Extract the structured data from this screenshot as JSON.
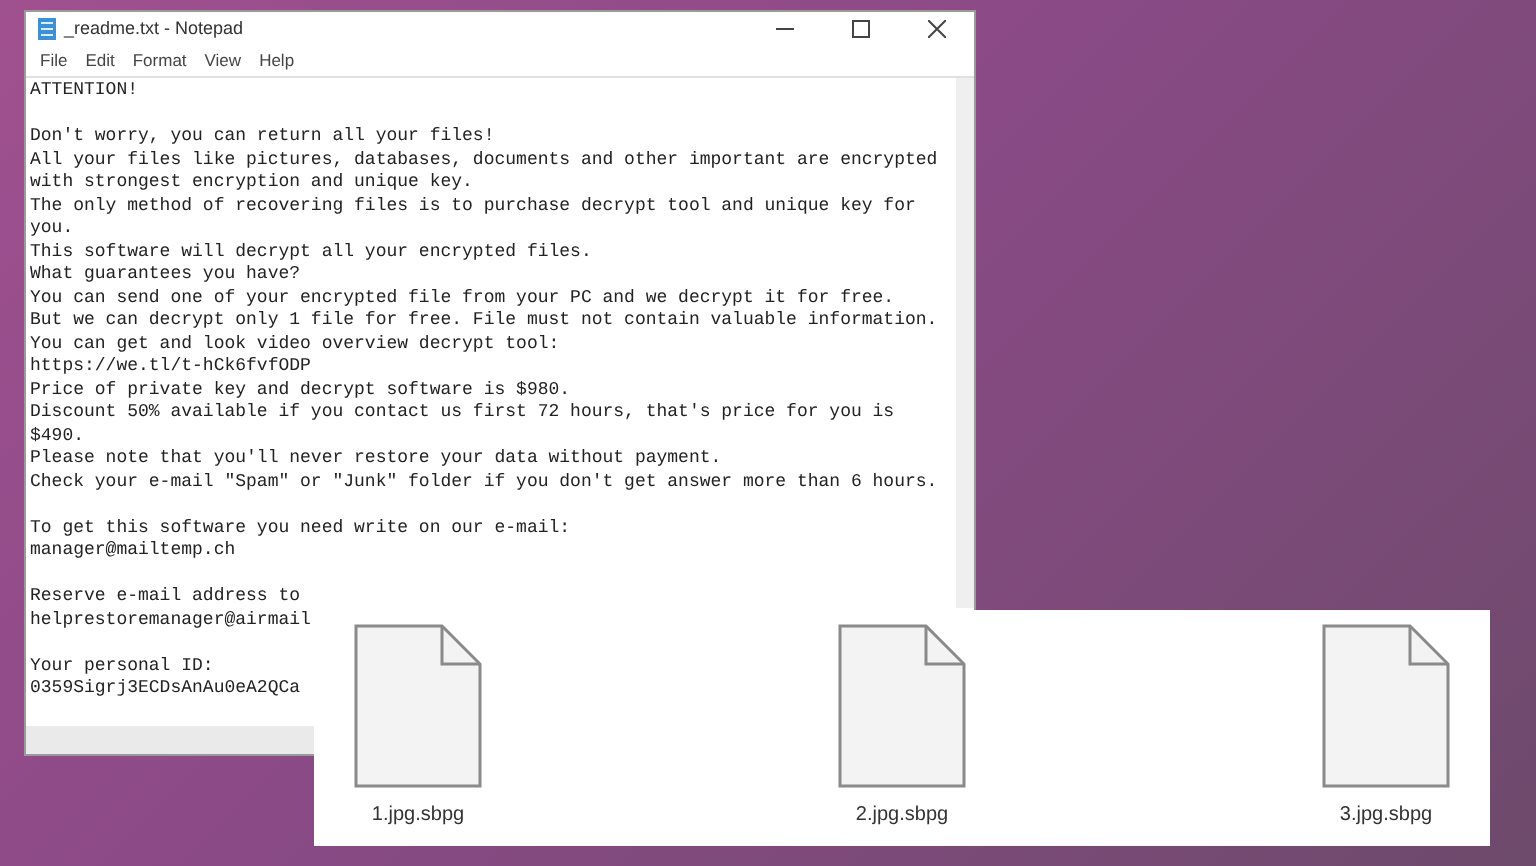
{
  "notepad": {
    "title": "_readme.txt - Notepad",
    "menu": [
      "File",
      "Edit",
      "Format",
      "View",
      "Help"
    ],
    "paragraphs": [
      {
        "lines": [
          "ATTENTION!"
        ]
      },
      {
        "lines": [
          "Don't worry, you can return all your files!",
          "All your files like pictures, databases, documents and other important are encrypted",
          "with strongest encryption and unique key.",
          "The only method of recovering files is to purchase decrypt tool and unique key for",
          "you.",
          "This software will decrypt all your encrypted files.",
          "What guarantees you have?",
          "You can send one of your encrypted file from your PC and we decrypt it for free.",
          "But we can decrypt only 1 file for free. File must not contain valuable information.",
          "You can get and look video overview decrypt tool:",
          "https://we.tl/t-hCk6fvfODP",
          "Price of private key and decrypt software is $980.",
          "Discount 50% available if you contact us first 72 hours, that's price for you is",
          "$490.",
          "Please note that you'll never restore your data without payment.",
          "Check your e-mail \"Spam\" or \"Junk\" folder if you don't get answer more than 6 hours."
        ]
      },
      {
        "lines": [
          "To get this software you need write on our e-mail:",
          "manager@mailtemp.ch"
        ]
      },
      {
        "lines": [
          "Reserve e-mail address to",
          "helprestoremanager@airmail"
        ]
      },
      {
        "lines": [
          "Your personal ID:",
          "0359Sigrj3ECDsAnAu0eA2QCa"
        ]
      }
    ]
  },
  "files": [
    {
      "name": "1.jpg.sbpg"
    },
    {
      "name": "2.jpg.sbpg"
    },
    {
      "name": "3.jpg.sbpg"
    }
  ]
}
